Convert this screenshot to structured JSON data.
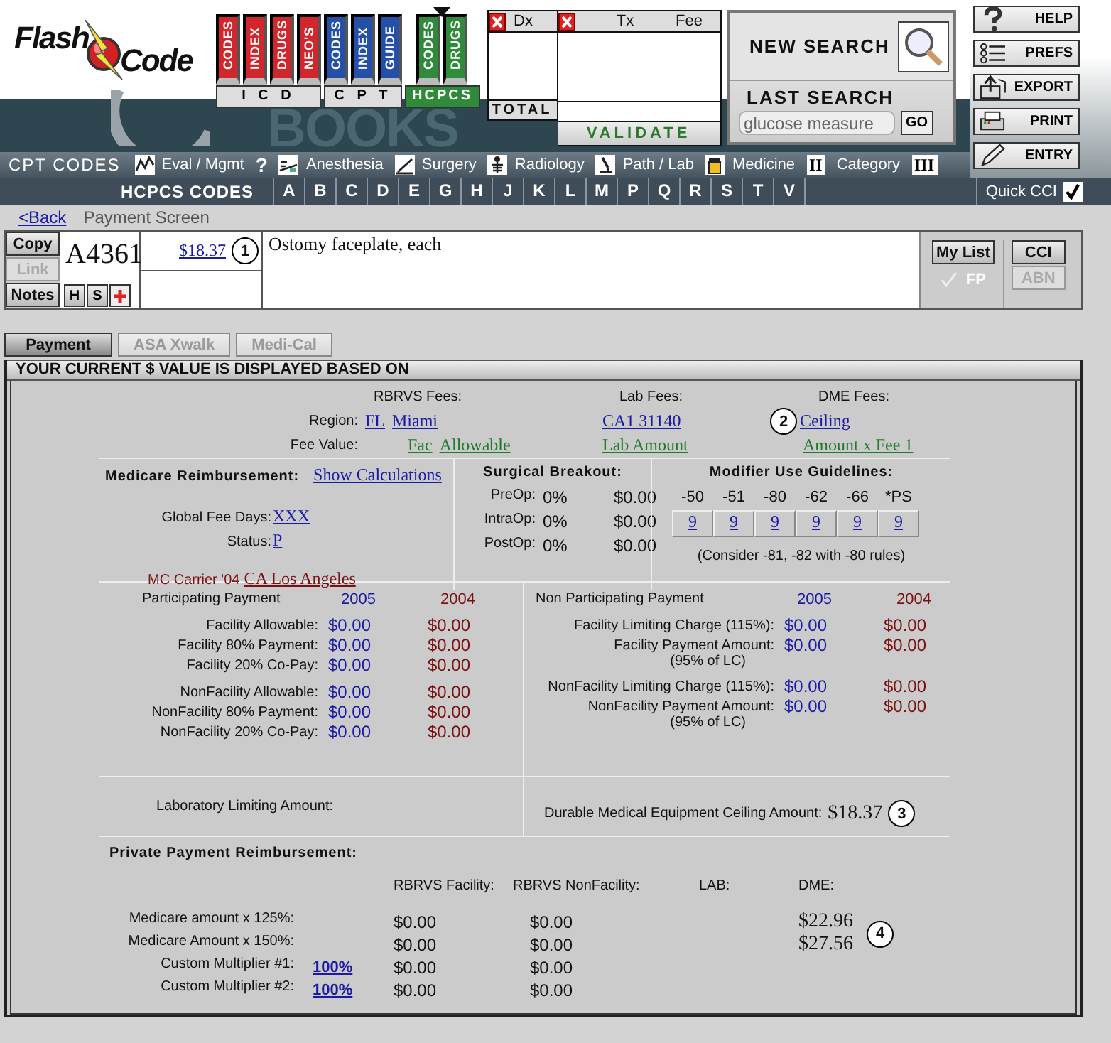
{
  "logo": {
    "first": "Flash",
    "second": "Code"
  },
  "header_art_text": "BOOKS",
  "book_groups": [
    {
      "label": "I C D",
      "color": "#d0262c",
      "selected": false,
      "books": [
        "CODES",
        "INDEX",
        "DRUGS",
        "NEO'S"
      ]
    },
    {
      "label": "C P T",
      "color": "#2450a8",
      "selected": false,
      "books": [
        "CODES",
        "INDEX",
        "GUIDE"
      ]
    },
    {
      "label": "HCPCS",
      "color": "#2f8a3a",
      "selected": true,
      "books": [
        "CODES",
        "DRUGS"
      ]
    }
  ],
  "dx_panel": {
    "header": "Dx",
    "total_label": "TOTAL"
  },
  "tx_panel": {
    "headers": [
      "Tx",
      "Fee"
    ],
    "validate": "VALIDATE"
  },
  "search": {
    "new_search": "NEW SEARCH",
    "last_search": "LAST SEARCH",
    "value": "glucose measure",
    "go": "GO"
  },
  "tools": [
    "HELP",
    "PREFS",
    "EXPORT",
    "PRINT",
    "ENTRY"
  ],
  "cpt_bar": {
    "title": "CPT CODES",
    "items": [
      {
        "label": "Eval / Mgmt",
        "kind": "icon"
      },
      {
        "label": "?",
        "kind": "glyph"
      },
      {
        "label": "Anesthesia",
        "kind": "icon"
      },
      {
        "label": "Surgery",
        "kind": "icon"
      },
      {
        "label": "Radiology",
        "kind": "icon"
      },
      {
        "label": "Path / Lab",
        "kind": "icon"
      },
      {
        "label": "Medicine",
        "kind": "icon"
      },
      {
        "label": "Category",
        "kind": "roman",
        "prefix": "II",
        "suffix": "III"
      }
    ]
  },
  "hcpcs_bar": {
    "title": "HCPCS CODES",
    "letters": [
      "A",
      "B",
      "C",
      "D",
      "E",
      "G",
      "H",
      "J",
      "K",
      "L",
      "M",
      "P",
      "Q",
      "R",
      "S",
      "T",
      "V"
    ],
    "quick_cci": {
      "label": "Quick CCI",
      "checked": true
    }
  },
  "breadcrumb": {
    "back": "<Back",
    "title": "Payment Screen"
  },
  "code_panel": {
    "buttons": [
      {
        "label": "Copy",
        "disabled": false
      },
      {
        "label": "Link",
        "disabled": true
      },
      {
        "label": "Notes",
        "disabled": false
      }
    ],
    "code": "A4361",
    "small_buttons": [
      "H",
      "S"
    ],
    "fee": "$18.37",
    "callout": "1",
    "description": "Ostomy faceplate, each",
    "my_list": "My List",
    "fp": {
      "label": "FP",
      "checked": true
    },
    "cci": {
      "label": "CCI",
      "disabled": false
    },
    "abn": {
      "label": "ABN",
      "disabled": true
    }
  },
  "tabs": [
    {
      "label": "Payment",
      "selected": true
    },
    {
      "label": "ASA Xwalk",
      "selected": false
    },
    {
      "label": "Medi-Cal",
      "selected": false
    }
  ],
  "panel_title": "YOUR CURRENT $ VALUE IS DISPLAYED BASED ON",
  "fees": {
    "region_label": "Region:",
    "fee_label": "Fee Value:",
    "rbrvs": {
      "header": "RBRVS Fees:",
      "region": [
        "FL",
        "Miami"
      ],
      "fee": [
        "Fac",
        "Allowable"
      ]
    },
    "lab": {
      "header": "Lab Fees:",
      "region": "CA1 31140",
      "fee": "Lab Amount"
    },
    "dme": {
      "header": "DME Fees:",
      "callout": "2",
      "region": "Ceiling",
      "fee": "Amount x Fee 1"
    }
  },
  "medicare": {
    "title": "Medicare Reimbursement:",
    "link": "Show Calculations",
    "global_label": "Global Fee Days:",
    "global": "XXX",
    "status_label": "Status:",
    "status": "P",
    "carrier_label": "MC Carrier '04",
    "carrier": "CA Los Angeles"
  },
  "surgical": {
    "title": "Surgical Breakout:",
    "rows": [
      {
        "label": "PreOp:",
        "percent": "0%",
        "amount": "$0.00"
      },
      {
        "label": "IntraOp:",
        "percent": "0%",
        "amount": "$0.00"
      },
      {
        "label": "PostOp:",
        "percent": "0%",
        "amount": "$0.00"
      }
    ]
  },
  "modifier": {
    "title": "Modifier Use Guidelines:",
    "columns": [
      {
        "code": "-50",
        "value": "9"
      },
      {
        "code": "-51",
        "value": "9"
      },
      {
        "code": "-80",
        "value": "9"
      },
      {
        "code": "-62",
        "value": "9"
      },
      {
        "code": "-66",
        "value": "9"
      },
      {
        "code": "*PS",
        "value": "9"
      }
    ],
    "note": "(Consider -81, -82 with -80 rules)"
  },
  "participating": {
    "title": "Participating Payment",
    "years": [
      "2005",
      "2004"
    ],
    "groups": [
      {
        "rows": [
          {
            "label": "Facility Allowable:",
            "values": [
              "$0.00",
              "$0.00"
            ]
          },
          {
            "label": "Facility 80% Payment:",
            "values": [
              "$0.00",
              "$0.00"
            ]
          },
          {
            "label": "Facility 20% Co-Pay:",
            "values": [
              "$0.00",
              "$0.00"
            ]
          }
        ]
      },
      {
        "rows": [
          {
            "label": "NonFacility Allowable:",
            "values": [
              "$0.00",
              "$0.00"
            ]
          },
          {
            "label": "NonFacility 80% Payment:",
            "values": [
              "$0.00",
              "$0.00"
            ]
          },
          {
            "label": "NonFacility 20% Co-Pay:",
            "values": [
              "$0.00",
              "$0.00"
            ]
          }
        ]
      }
    ]
  },
  "non_participating": {
    "title": "Non Participating Payment",
    "years": [
      "2005",
      "2004"
    ],
    "groups": [
      {
        "rows": [
          {
            "label": "Facility Limiting Charge (115%):",
            "values": [
              "$0.00",
              "$0.00"
            ]
          },
          {
            "label": "Facility Payment Amount:",
            "sublabel": "(95% of LC)",
            "values": [
              "$0.00",
              "$0.00"
            ]
          }
        ]
      },
      {
        "rows": [
          {
            "label": "NonFacility Limiting Charge (115%):",
            "values": [
              "$0.00",
              "$0.00"
            ]
          },
          {
            "label": "NonFacility Payment Amount:",
            "sublabel": "(95% of LC)",
            "values": [
              "$0.00",
              "$0.00"
            ]
          }
        ]
      }
    ]
  },
  "lab_limit": {
    "label": "Laboratory Limiting Amount:"
  },
  "dme_ceiling": {
    "label": "Durable Medical Equipment Ceiling Amount:",
    "value": "$18.37",
    "callout": "3"
  },
  "private": {
    "title": "Private Payment Reimbursement:",
    "columns": [
      "RBRVS Facility:",
      "RBRVS NonFacility:",
      "LAB:",
      "DME:"
    ],
    "callout": "4",
    "rows": [
      {
        "label": "Medicare amount x 125%:",
        "facility": "$0.00",
        "nonfacility": "$0.00",
        "dme": "$22.96"
      },
      {
        "label": "Medicare Amount x 150%:",
        "facility": "$0.00",
        "nonfacility": "$0.00",
        "dme": "$27.56"
      },
      {
        "label": "Custom Multiplier #1:",
        "multiplier": "100%",
        "facility": "$0.00",
        "nonfacility": "$0.00"
      },
      {
        "label": "Custom Multiplier #2:",
        "multiplier": "100%",
        "facility": "$0.00",
        "nonfacility": "$0.00"
      }
    ]
  }
}
